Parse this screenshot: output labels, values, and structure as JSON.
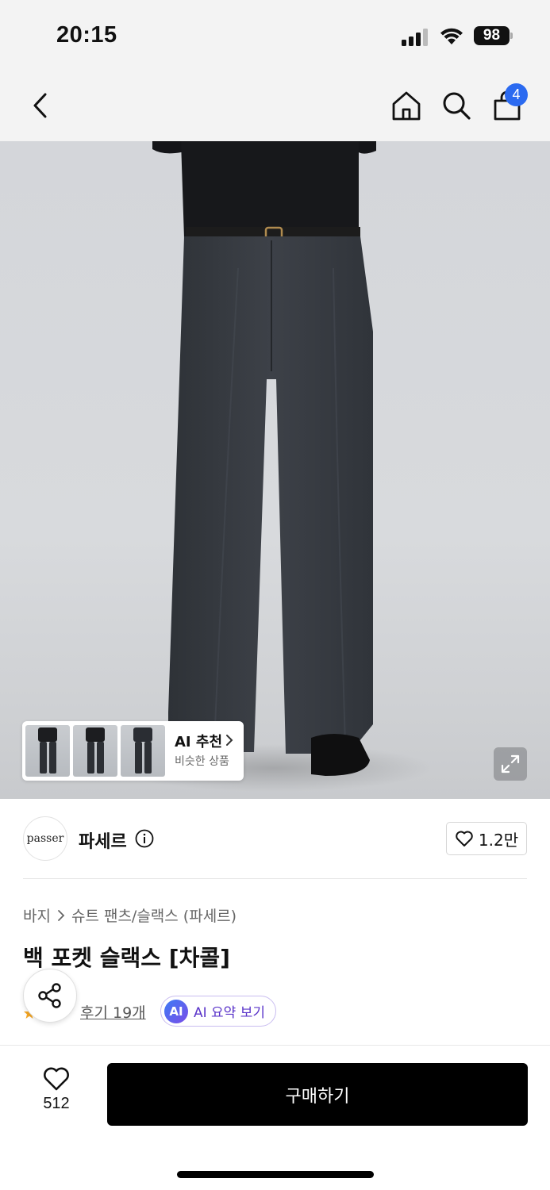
{
  "status_bar": {
    "time": "20:15",
    "battery": "98"
  },
  "nav": {
    "cart_count": "4"
  },
  "ai_recommend": {
    "title": "AI 추천",
    "subtitle": "비슷한 상품"
  },
  "brand": {
    "logo_text": "passer",
    "name": "파세르",
    "like_count": "1.2만"
  },
  "breadcrumb": {
    "category": "바지",
    "subcategory": "슈트 팬츠/슬랙스 (파세르)"
  },
  "product": {
    "title": "백 포켓 슬랙스 [차콜]"
  },
  "reviews": {
    "label": "후기 19개"
  },
  "ai_summary": {
    "badge": "AI",
    "label": "AI 요약 보기"
  },
  "bottom": {
    "wish_count": "512",
    "buy_label": "구매하기"
  },
  "colors": {
    "accent_blue": "#2b6af0",
    "ai_purple": "#5a34c9",
    "buy_button": "#000000",
    "rating_star": "#f5a623"
  }
}
